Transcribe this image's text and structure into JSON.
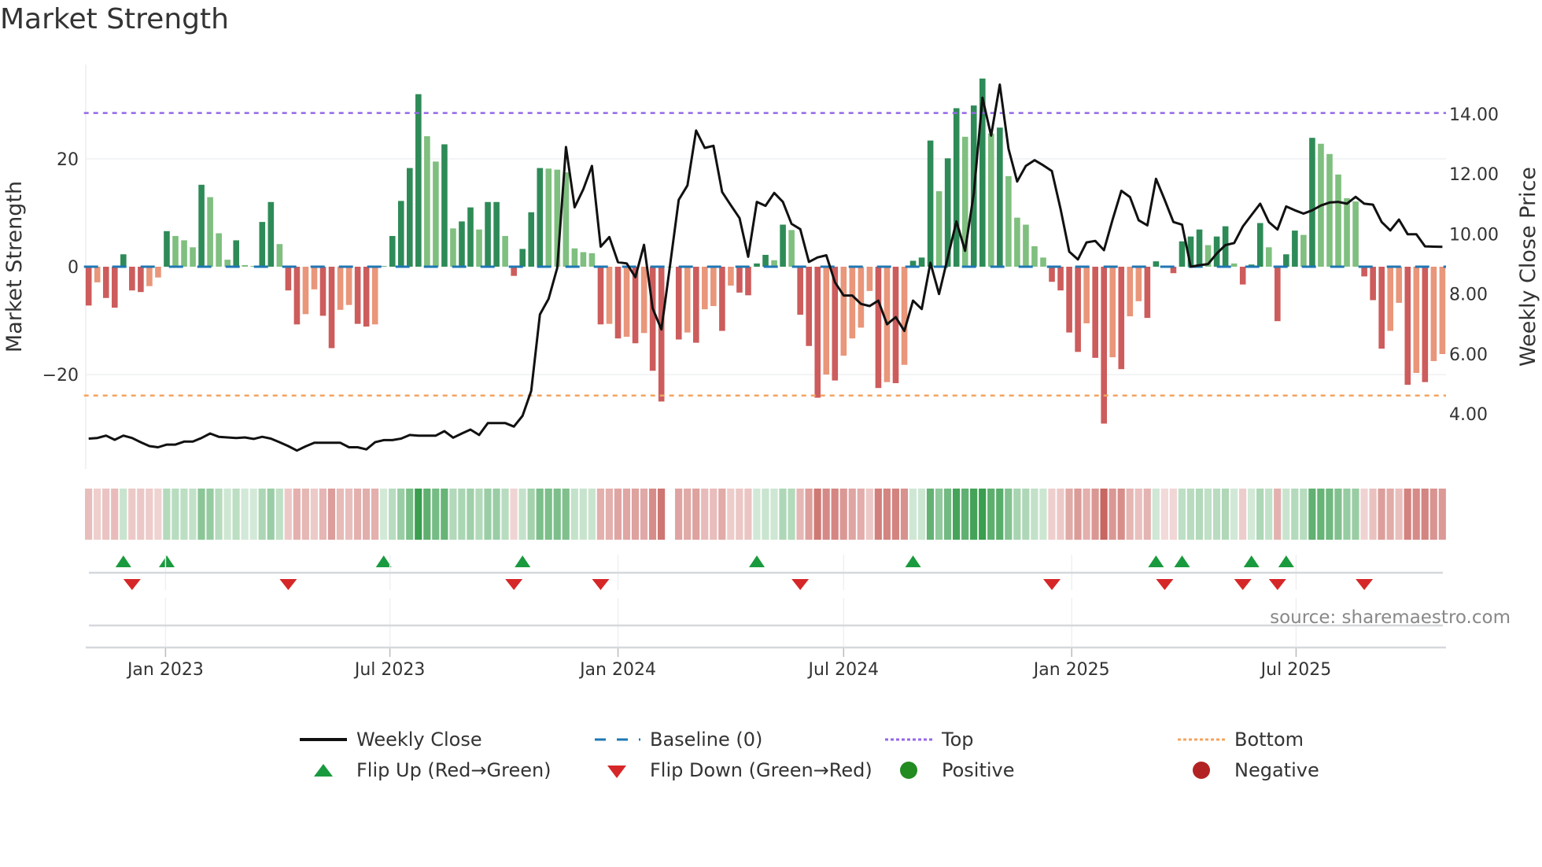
{
  "title": "Market Strength",
  "source": "source: sharemaestro.com",
  "chart_data": {
    "type": "bar+line",
    "title": "Market Strength",
    "x_start": "2022-10-31",
    "x_step_days": 7,
    "x_ticks": [
      {
        "label": "Jan 2023",
        "date": "2023-01-01"
      },
      {
        "label": "Jul 2023",
        "date": "2023-07-01"
      },
      {
        "label": "Jan 2024",
        "date": "2024-01-01"
      },
      {
        "label": "Jul 2024",
        "date": "2024-07-01"
      },
      {
        "label": "Jan 2025",
        "date": "2025-01-01"
      },
      {
        "label": "Jul 2025",
        "date": "2025-07-01"
      }
    ],
    "y_left": {
      "label": "Market Strength",
      "lim": [
        -37.5,
        37.5
      ],
      "ticks": [
        {
          "v": -20,
          "label": "−20"
        },
        {
          "v": 0,
          "label": "0"
        },
        {
          "v": 20,
          "label": "20"
        }
      ]
    },
    "y_right": {
      "label": "Weekly Close Price",
      "lim": [
        2.17,
        15.65
      ],
      "ticks": [
        {
          "v": 4,
          "label": "4.00"
        },
        {
          "v": 6,
          "label": "6.00"
        },
        {
          "v": 8,
          "label": "8.00"
        },
        {
          "v": 10,
          "label": "10.00"
        },
        {
          "v": 12,
          "label": "12.00"
        },
        {
          "v": 14,
          "label": "14.00"
        }
      ]
    },
    "top_level": 28.5,
    "bottom_level": -23.9,
    "baseline": 0,
    "strength": [
      -7.2,
      -2.9,
      -5.8,
      -7.6,
      2.3,
      -4.4,
      -4.7,
      -3.6,
      -2.0,
      6.6,
      5.7,
      4.9,
      3.6,
      15.2,
      12.9,
      6.2,
      1.3,
      4.9,
      0.3,
      0.15,
      8.3,
      12.0,
      4.2,
      -4.4,
      -10.7,
      -8.8,
      -4.2,
      -9.1,
      -15.1,
      -8.0,
      -7.1,
      -10.6,
      -11.1,
      -10.7,
      0.1,
      5.7,
      12.2,
      18.3,
      32.0,
      24.2,
      19.5,
      22.7,
      7.1,
      8.4,
      11.0,
      6.9,
      12.0,
      12.0,
      5.7,
      -1.7,
      3.3,
      10.1,
      18.3,
      18.2,
      18.0,
      17.5,
      3.4,
      2.7,
      2.5,
      -10.7,
      -10.6,
      -13.3,
      -13.0,
      -14.2,
      -12.3,
      -19.3,
      -25.0,
      0,
      -13.5,
      -12.2,
      -14.1,
      -7.9,
      -7.3,
      -11.9,
      -3.5,
      -4.8,
      -5.3,
      0.6,
      2.2,
      1.2,
      7.8,
      6.8,
      -8.9,
      -14.7,
      -24.3,
      -20.0,
      -21.1,
      -16.5,
      -13.3,
      -11.3,
      -4.5,
      -22.5,
      -21.4,
      -21.6,
      -18.2,
      1.1,
      1.7,
      23.4,
      14.0,
      20.1,
      29.4,
      24.1,
      29.9,
      34.9,
      24.7,
      25.8,
      16.8,
      9.1,
      7.8,
      3.8,
      1.7,
      -2.8,
      -4.4,
      -12.2,
      -15.8,
      -10.5,
      -16.9,
      -29.1,
      -16.8,
      -19.0,
      -9.2,
      -6.4,
      -9.5,
      1.0,
      -0.1,
      -1.2,
      4.7,
      5.6,
      6.9,
      4.0,
      5.6,
      7.5,
      0.6,
      -3.3,
      0.4,
      8.1,
      3.6,
      -10.1,
      2.3,
      6.7,
      5.9,
      23.9,
      22.8,
      20.9,
      17.1,
      12.7,
      12.1,
      -1.8,
      -6.2,
      -15.2,
      -11.9,
      -6.7,
      -21.9,
      -19.7,
      -21.4,
      -17.5,
      -16.2
    ],
    "weekly_close": [
      3.18,
      3.2,
      3.28,
      3.14,
      3.28,
      3.2,
      3.06,
      2.93,
      2.89,
      2.98,
      2.98,
      3.08,
      3.08,
      3.2,
      3.35,
      3.24,
      3.22,
      3.2,
      3.22,
      3.17,
      3.24,
      3.18,
      3.06,
      2.93,
      2.78,
      2.92,
      3.04,
      3.04,
      3.04,
      3.04,
      2.89,
      2.89,
      2.82,
      3.06,
      3.13,
      3.13,
      3.18,
      3.3,
      3.28,
      3.28,
      3.28,
      3.43,
      3.21,
      3.35,
      3.48,
      3.3,
      3.7,
      3.7,
      3.7,
      3.58,
      3.94,
      4.77,
      7.32,
      7.84,
      8.87,
      12.9,
      10.89,
      11.49,
      12.27,
      9.58,
      9.9,
      9.06,
      9.02,
      8.56,
      9.64,
      7.52,
      6.82,
      8.96,
      11.14,
      11.62,
      13.45,
      12.87,
      12.94,
      11.4,
      10.96,
      10.53,
      9.24,
      11.07,
      10.94,
      11.37,
      11.07,
      10.34,
      10.16,
      9.07,
      9.22,
      9.29,
      8.39,
      7.95,
      7.95,
      7.67,
      7.6,
      7.78,
      6.99,
      7.23,
      6.77,
      7.78,
      7.5,
      9.04,
      8.0,
      9.22,
      10.42,
      9.44,
      11.36,
      14.54,
      13.28,
      14.98,
      12.84,
      11.75,
      12.27,
      12.46,
      12.29,
      12.1,
      10.83,
      9.41,
      9.15,
      9.72,
      9.77,
      9.46,
      10.48,
      11.44,
      11.23,
      10.46,
      10.29,
      11.84,
      11.14,
      10.4,
      10.31,
      8.91,
      8.96,
      9.0,
      9.35,
      9.63,
      9.7,
      10.25,
      10.63,
      11.01,
      10.4,
      10.15,
      10.92,
      10.79,
      10.68,
      10.79,
      10.95,
      11.05,
      11.07,
      11.01,
      11.24,
      11.01,
      10.98,
      10.4,
      10.12,
      10.48,
      9.99,
      9.99,
      9.59,
      9.58,
      9.57
    ],
    "colors": {
      "pos_up": "#2e8b57",
      "pos_down": "#7fbf7f",
      "neg_down": "#cd5c5c",
      "neg_up": "#e9967a",
      "line": "#111111",
      "baseline": "#1f77b4",
      "top": "#9467e8",
      "bottom": "#f4a460",
      "flip_up": "#1a9a3e",
      "flip_down": "#d62728",
      "positive": "#228b22",
      "negative": "#b22222"
    },
    "legend": [
      {
        "key": "line",
        "label": "Weekly Close"
      },
      {
        "key": "baseline",
        "label": "Baseline (0)"
      },
      {
        "key": "top",
        "label": "Top"
      },
      {
        "key": "bottom",
        "label": "Bottom"
      },
      {
        "key": "flip_up",
        "label": "Flip Up (Red→Green)"
      },
      {
        "key": "flip_down",
        "label": "Flip Down (Green→Red)"
      },
      {
        "key": "positive",
        "label": "Positive"
      },
      {
        "key": "negative",
        "label": "Negative"
      }
    ],
    "legend_position": "bottom-center"
  }
}
